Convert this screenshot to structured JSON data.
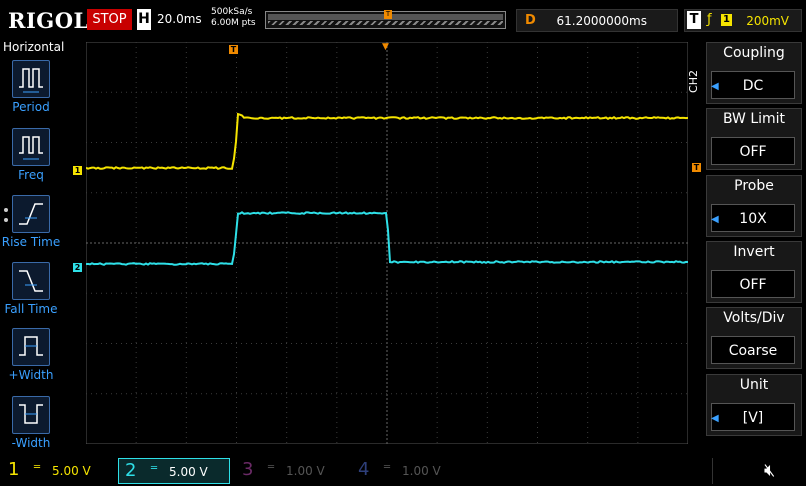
{
  "topbar": {
    "logo": "RIGOL",
    "status": "STOP",
    "h_label": "H",
    "timebase": "20.0ms",
    "sample_rate": "500kSa/s",
    "mem_depth": "6.00M pts",
    "delay_label": "D",
    "delay_value": "61.2000000ms",
    "trig_label": "T",
    "trig_edge": "ƒ",
    "trig_channel": "1",
    "trig_level": "200mV",
    "memory_trigger_mark": "T"
  },
  "left_menu": {
    "title": "Horizontal",
    "items": [
      {
        "label": "Period"
      },
      {
        "label": "Freq"
      },
      {
        "label": "Rise Time"
      },
      {
        "label": "Fall Time"
      },
      {
        "label": "+Width"
      },
      {
        "label": "-Width"
      }
    ]
  },
  "display": {
    "ch1_marker": "1",
    "ch2_marker": "2",
    "trigger_pos_marker": "T",
    "trigger_level_marker": "T",
    "ch1_color": "#f5e400",
    "ch2_color": "#2ee0e8",
    "trigger_color": "#f08a00"
  },
  "right_menu": {
    "channel_label": "CH2",
    "items": [
      {
        "title": "Coupling",
        "value": "DC"
      },
      {
        "title": "BW Limit",
        "value": "OFF"
      },
      {
        "title": "Probe",
        "value": "10X"
      },
      {
        "title": "Invert",
        "value": "OFF"
      },
      {
        "title": "Volts/Div",
        "value": "Coarse"
      },
      {
        "title": "Unit",
        "value": "[V]"
      }
    ]
  },
  "channels": [
    {
      "num": "1",
      "coupling": "═",
      "scale": "5.00 V",
      "color": "#f5e400"
    },
    {
      "num": "2",
      "coupling": "═",
      "scale": "5.00 V",
      "color": "#2ee0e8"
    },
    {
      "num": "3",
      "coupling": "═",
      "scale": "1.00 V",
      "color": "#c21bb8"
    },
    {
      "num": "4",
      "coupling": "═",
      "scale": "1.00 V",
      "color": "#3a6bd8"
    }
  ],
  "sound_icon": "speaker-muted-icon"
}
